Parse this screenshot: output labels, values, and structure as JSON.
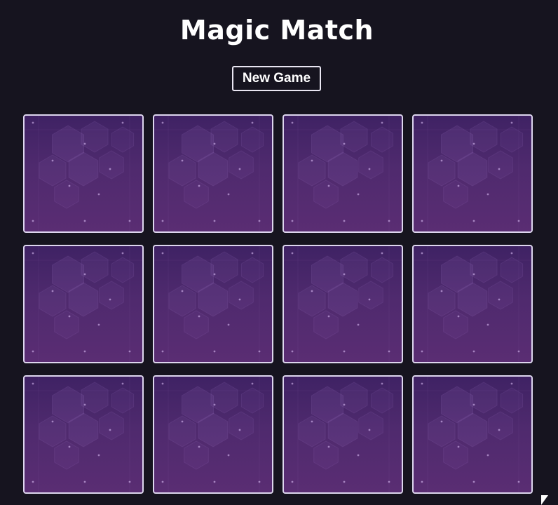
{
  "app": {
    "title": "Magic Match"
  },
  "controls": {
    "new_game_label": "New Game"
  },
  "board": {
    "rows": 3,
    "columns": 4,
    "cards": [
      {
        "state": "face-down"
      },
      {
        "state": "face-down"
      },
      {
        "state": "face-down"
      },
      {
        "state": "face-down"
      },
      {
        "state": "face-down"
      },
      {
        "state": "face-down"
      },
      {
        "state": "face-down"
      },
      {
        "state": "face-down"
      },
      {
        "state": "face-down"
      },
      {
        "state": "face-down"
      },
      {
        "state": "face-down"
      },
      {
        "state": "face-down"
      }
    ]
  },
  "theme": {
    "background": "#16141f",
    "card_back_top": "#3f2264",
    "card_back_bottom": "#5a2d73",
    "card_border": "#ddd6ee",
    "text": "#ffffff"
  },
  "icons": {
    "card_back": "hexagon-pattern-icon",
    "cursor": "mouse-cursor-icon"
  }
}
